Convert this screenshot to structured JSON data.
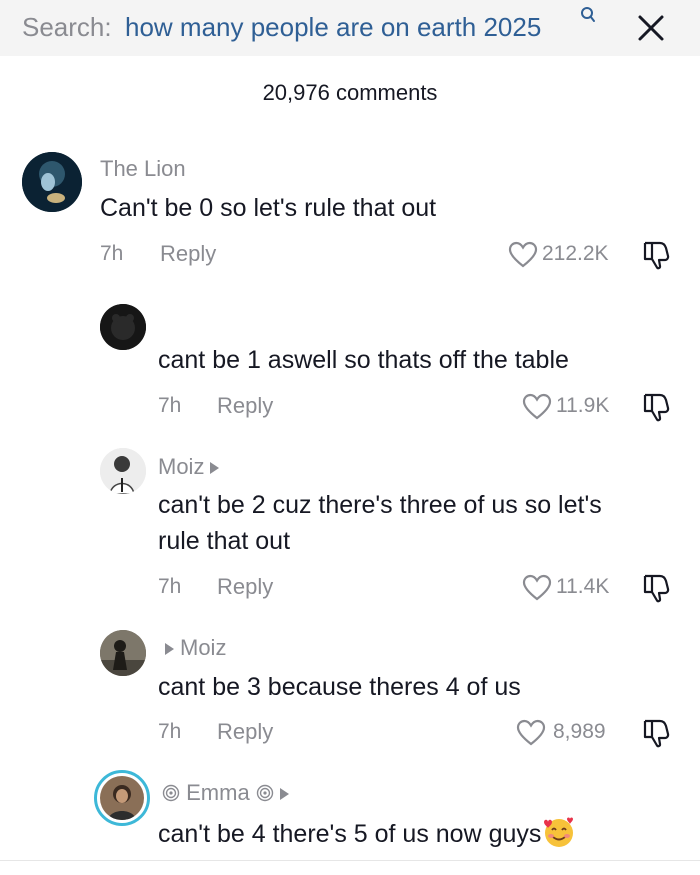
{
  "search": {
    "prefix": "Search:",
    "query": "how many people are on earth 2025",
    "query_icon": "search-q-icon",
    "close_icon": "close-icon"
  },
  "comments_header": {
    "count_text": "20,976 comments"
  },
  "comments": [
    {
      "username": "The Lion",
      "text": "Can't be 0 so let's rule that out",
      "time": "7h",
      "reply_label": "Reply",
      "likes": "212.2K"
    },
    {
      "username": "",
      "text": "cant be 1 aswell so thats off the table",
      "time": "7h",
      "reply_label": "Reply",
      "likes": "11.9K"
    },
    {
      "username": "Moiz",
      "text_line1": "can't be 2 cuz there's three of us so let's",
      "text_line2": "rule that out",
      "time": "7h",
      "reply_label": "Reply",
      "likes": "11.4K"
    },
    {
      "reply_to": "Moiz",
      "text": "cant be 3 because theres 4 of us",
      "time": "7h",
      "reply_label": "Reply",
      "likes": "8,989"
    },
    {
      "username": "Emma",
      "text": "can't be 4 there's 5 of us now guys"
    }
  ],
  "colors": {
    "text_primary": "#161823",
    "text_secondary": "#8a8b91",
    "search_query": "#2f5f95",
    "search_bg": "#f4f4f4",
    "avatar_ring": "#3db8d8"
  }
}
